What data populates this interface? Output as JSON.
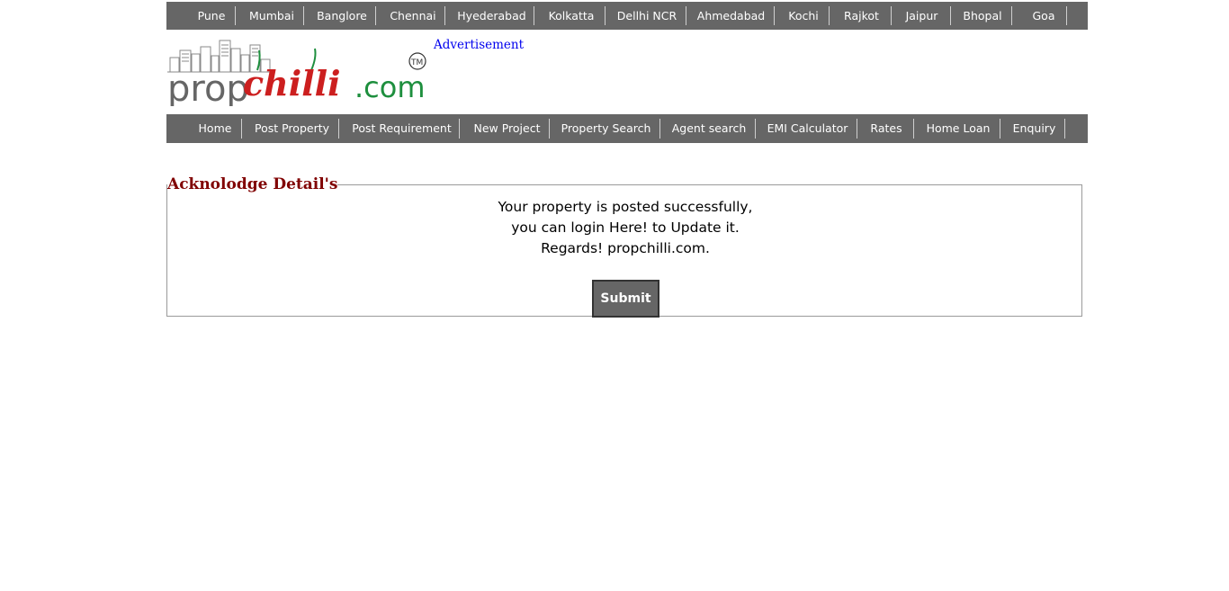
{
  "city_nav": [
    {
      "label": "Pune"
    },
    {
      "label": "Mumbai"
    },
    {
      "label": "Banglore"
    },
    {
      "label": "Chennai"
    },
    {
      "label": "Hyederabad"
    },
    {
      "label": "Kolkatta"
    },
    {
      "label": "Dellhi NCR"
    },
    {
      "label": "Ahmedabad"
    },
    {
      "label": "Kochi"
    },
    {
      "label": "Rajkot"
    },
    {
      "label": "Jaipur"
    },
    {
      "label": "Bhopal"
    },
    {
      "label": "Goa"
    }
  ],
  "logo": {
    "prop": "prop",
    "chilli": "chilli",
    "com": ".com",
    "tm": "TM"
  },
  "advertisement": "Advertisement",
  "main_nav": [
    {
      "label": "Home"
    },
    {
      "label": "Post Property"
    },
    {
      "label": "Post Requirement"
    },
    {
      "label": "New Project"
    },
    {
      "label": "Property Search"
    },
    {
      "label": "Agent search"
    },
    {
      "label": "EMI Calculator"
    },
    {
      "label": "Rates"
    },
    {
      "label": "Home Loan"
    },
    {
      "label": "Enquiry"
    }
  ],
  "ack": {
    "legend": "Acknolodge Detail's",
    "line1": "Your property is posted successfully,",
    "line2": "you can login Here! to Update it.",
    "line3": "Regards! propchilli.com.",
    "submit_label": "Submit"
  },
  "colors": {
    "nav_bg": "#666666",
    "legend": "#800000",
    "logo_grey": "#666666",
    "logo_red": "#cc1f1f",
    "logo_green": "#1e8f3e",
    "link": "#0000ee"
  }
}
